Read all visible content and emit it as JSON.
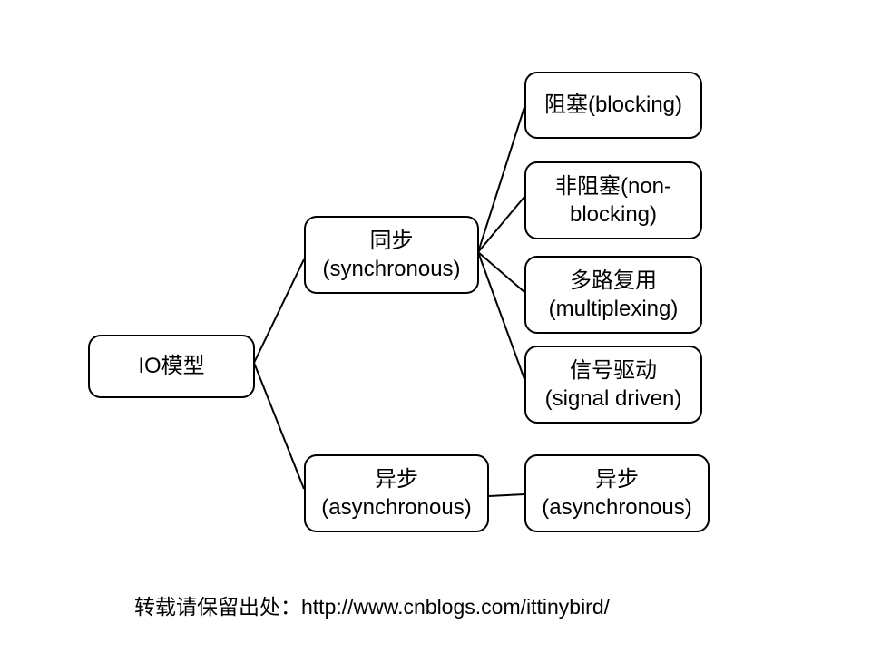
{
  "nodes": {
    "root": "IO模型",
    "sync": "同步\n(synchronous)",
    "async": "异步\n(asynchronous)",
    "blocking": "阻塞(blocking)",
    "nonblocking": "非阻塞(non-\nblocking)",
    "multiplexing": "多路复用\n(multiplexing)",
    "signal": "信号驱动\n(signal driven)",
    "async_leaf": "异步\n(asynchronous)"
  },
  "attribution": "转载请保留出处：http://www.cnblogs.com/ittinybird/"
}
